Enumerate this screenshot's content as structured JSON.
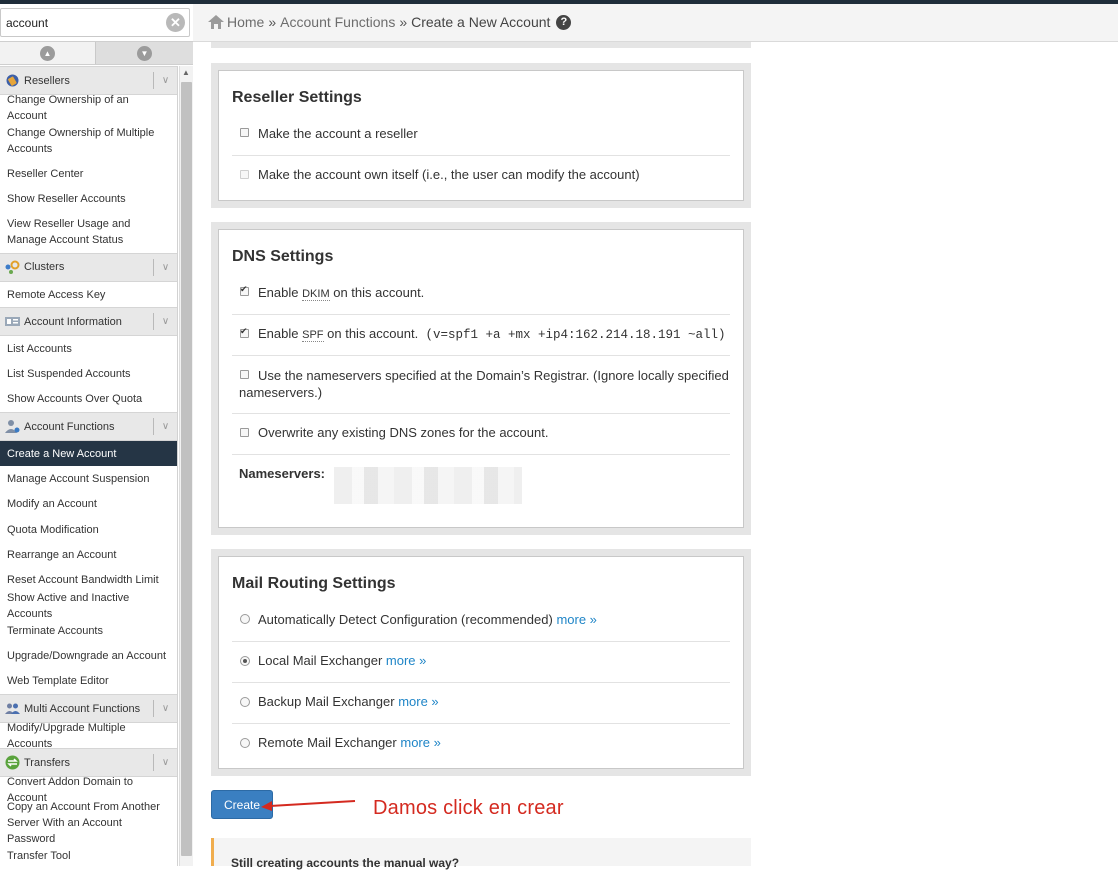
{
  "search": {
    "value": "account"
  },
  "breadcrumb": {
    "home": "Home",
    "sep": "»",
    "section": "Account Functions",
    "current": "Create a New Account"
  },
  "sidebar": {
    "resellers": {
      "title": "Resellers",
      "items": [
        "Change Ownership of an Account",
        "Change Ownership of Multiple Accounts",
        "Reseller Center",
        "Show Reseller Accounts",
        "View Reseller Usage and Manage Account Status"
      ]
    },
    "clusters": {
      "title": "Clusters",
      "items": [
        "Remote Access Key"
      ]
    },
    "account_information": {
      "title": "Account Information",
      "items": [
        "List Accounts",
        "List Suspended Accounts",
        "Show Accounts Over Quota"
      ]
    },
    "account_functions": {
      "title": "Account Functions",
      "items": [
        "Create a New Account",
        "Manage Account Suspension",
        "Modify an Account",
        "Quota Modification",
        "Rearrange an Account",
        "Reset Account Bandwidth Limit",
        "Show Active and Inactive Accounts",
        "Terminate Accounts",
        "Upgrade/Downgrade an Account",
        "Web Template Editor"
      ]
    },
    "multi_account_functions": {
      "title": "Multi Account Functions",
      "items": [
        "Modify/Upgrade Multiple Accounts"
      ]
    },
    "transfers": {
      "title": "Transfers",
      "items": [
        "Convert Addon Domain to Account",
        "Copy an Account From Another Server With an Account Password",
        "Transfer Tool"
      ]
    }
  },
  "reseller_settings": {
    "title": "Reseller Settings",
    "make_reseller": "Make the account a reseller",
    "own_itself": "Make the account own itself (i.e., the user can modify the account)"
  },
  "dns_settings": {
    "title": "DNS Settings",
    "enable": "Enable",
    "dkim_abbr": "DKIM",
    "dkim_suffix": "on this account.",
    "spf_abbr": "SPF",
    "spf_suffix": "on this account.",
    "spf_record": "(v=spf1 +a +mx +ip4:162.214.18.191 ~all)",
    "registrar_ns": "Use the nameservers specified at the Domain’s Registrar. (Ignore locally specified nameservers.)",
    "overwrite_zones": "Overwrite any existing DNS zones for the account.",
    "nameservers_label": "Nameservers:"
  },
  "mail_routing": {
    "title": "Mail Routing Settings",
    "auto": "Automatically Detect Configuration (recommended)",
    "local": "Local Mail Exchanger",
    "backup": "Backup Mail Exchanger",
    "remote": "Remote Mail Exchanger",
    "more": "more »"
  },
  "create_button": "Create",
  "annotation": "Damos click en crear",
  "tip": "Still creating accounts the manual way?"
}
